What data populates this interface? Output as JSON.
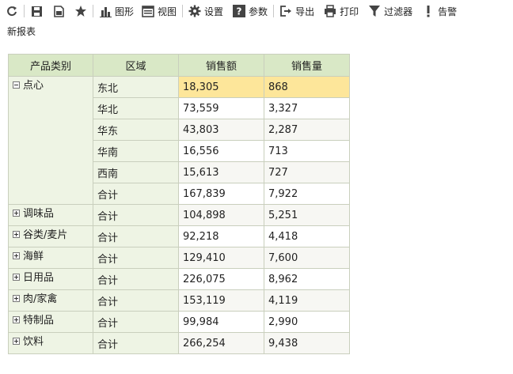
{
  "toolbar": {
    "chart": "图形",
    "view": "视图",
    "settings": "设置",
    "params": "参数",
    "export": "导出",
    "print": "打印",
    "filter": "过滤器",
    "alert": "告警"
  },
  "report_title": "新报表",
  "table": {
    "headers": [
      "产品类别",
      "区域",
      "销售额",
      "销售量"
    ],
    "expanded": {
      "category": "点心",
      "rows": [
        {
          "region": "东北",
          "sales": "18,305",
          "qty": "868"
        },
        {
          "region": "华北",
          "sales": "73,559",
          "qty": "3,327"
        },
        {
          "region": "华东",
          "sales": "43,803",
          "qty": "2,287"
        },
        {
          "region": "华南",
          "sales": "16,556",
          "qty": "713"
        },
        {
          "region": "西南",
          "sales": "15,613",
          "qty": "727"
        },
        {
          "region": "合计",
          "sales": "167,839",
          "qty": "7,922"
        }
      ]
    },
    "collapsed": [
      {
        "category": "调味品",
        "region": "合计",
        "sales": "104,898",
        "qty": "5,251"
      },
      {
        "category": "谷类/麦片",
        "region": "合计",
        "sales": "92,218",
        "qty": "4,418"
      },
      {
        "category": "海鲜",
        "region": "合计",
        "sales": "129,410",
        "qty": "7,600"
      },
      {
        "category": "日用品",
        "region": "合计",
        "sales": "226,075",
        "qty": "8,962"
      },
      {
        "category": "肉/家禽",
        "region": "合计",
        "sales": "153,119",
        "qty": "4,119"
      },
      {
        "category": "特制品",
        "region": "合计",
        "sales": "99,984",
        "qty": "2,990"
      },
      {
        "category": "饮料",
        "region": "合计",
        "sales": "266,254",
        "qty": "9,438"
      }
    ]
  },
  "colors": {
    "header_bg": "#d9e8c6",
    "dim_bg": "#eef4e4",
    "highlight": "#fde69a"
  }
}
